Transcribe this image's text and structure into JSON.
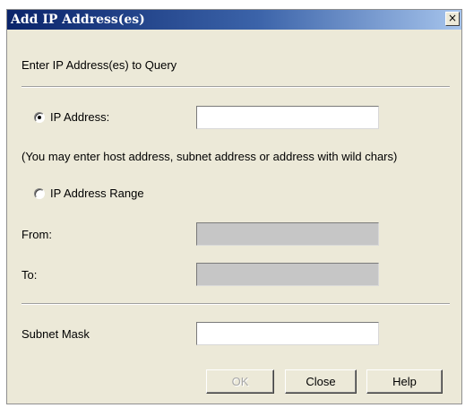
{
  "window": {
    "title": "Add IP Address(es)",
    "close_glyph": "×",
    "close_icon": "close-icon"
  },
  "prompt": "Enter IP Address(es) to Query",
  "ip_address": {
    "label": "IP Address:",
    "selected": true,
    "value": ""
  },
  "hint": "(You may enter host address, subnet address or address with wild chars)",
  "ip_range": {
    "label": "IP Address Range",
    "selected": false,
    "from_label": "From:",
    "from_value": "",
    "to_label": "To:",
    "to_value": ""
  },
  "subnet": {
    "label": "Subnet Mask",
    "value": ""
  },
  "buttons": {
    "ok": "OK",
    "close": "Close",
    "help": "Help"
  },
  "colors": {
    "dialog_bg": "#ece9d8",
    "title_start": "#0a246a",
    "title_end": "#a6c4ec",
    "disabled_field": "#c6c6c6"
  }
}
